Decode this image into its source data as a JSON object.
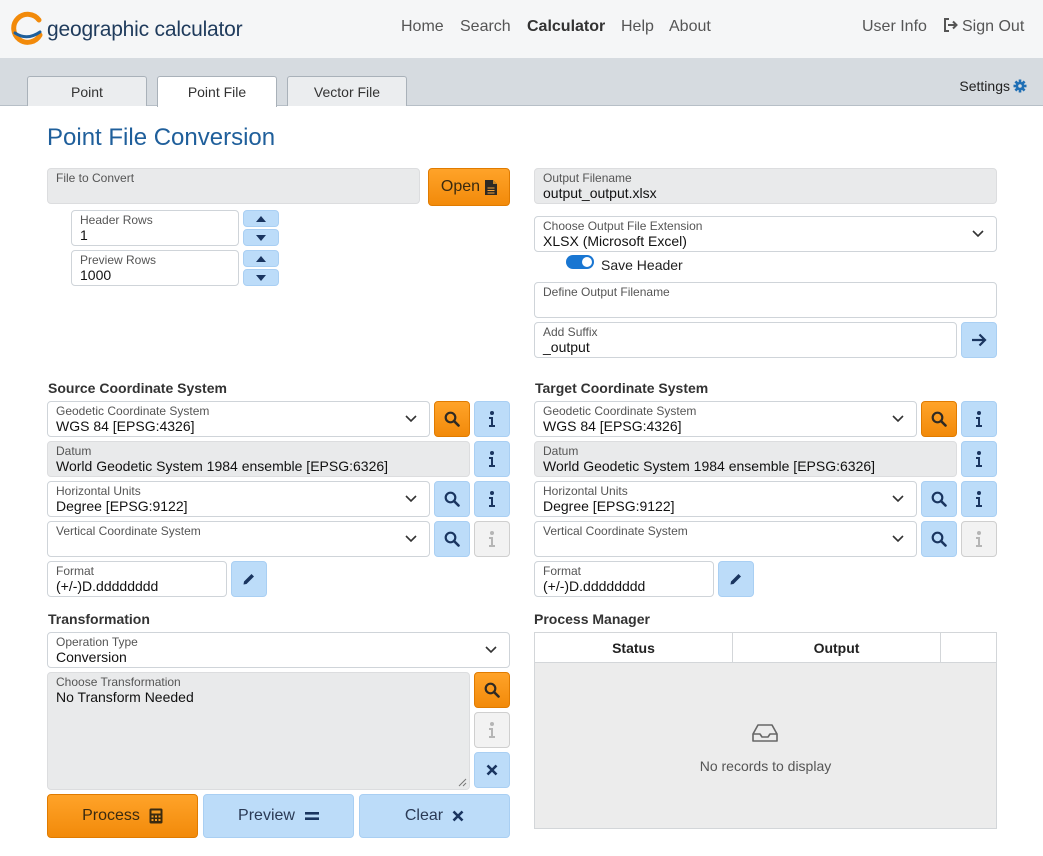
{
  "app": {
    "brand": "geographic calculator"
  },
  "nav": {
    "home": "Home",
    "search": "Search",
    "calculator": "Calculator",
    "help": "Help",
    "about": "About",
    "user_info": "User Info",
    "sign_out": "Sign Out"
  },
  "tabs": {
    "point": "Point",
    "point_file": "Point File",
    "vector_file": "Vector File",
    "settings": "Settings"
  },
  "page": {
    "title": "Point File Conversion"
  },
  "input": {
    "file_label": "File to Convert",
    "file_value": "",
    "open_label": "Open",
    "header_rows_label": "Header Rows",
    "header_rows_value": "1",
    "preview_rows_label": "Preview Rows",
    "preview_rows_value": "1000"
  },
  "output": {
    "filename_label": "Output Filename",
    "filename_value": "output_output.xlsx",
    "extension_label": "Choose Output File Extension",
    "extension_value": "XLSX (Microsoft Excel)",
    "save_header_label": "Save Header",
    "save_header_on": true,
    "define_label": "Define Output Filename",
    "define_value": "",
    "suffix_label": "Add Suffix",
    "suffix_value": "_output"
  },
  "source": {
    "section": "Source Coordinate System",
    "gcs_label": "Geodetic Coordinate System",
    "gcs_value": "WGS 84 [EPSG:4326]",
    "datum_label": "Datum",
    "datum_value": "World Geodetic System 1984 ensemble [EPSG:6326]",
    "hunits_label": "Horizontal Units",
    "hunits_value": "Degree [EPSG:9122]",
    "vcs_label": "Vertical Coordinate System",
    "vcs_value": "",
    "format_label": "Format",
    "format_value": "(+/-)D.dddddddd"
  },
  "target": {
    "section": "Target Coordinate System",
    "gcs_label": "Geodetic Coordinate System",
    "gcs_value": "WGS 84 [EPSG:4326]",
    "datum_label": "Datum",
    "datum_value": "World Geodetic System 1984 ensemble [EPSG:6326]",
    "hunits_label": "Horizontal Units",
    "hunits_value": "Degree [EPSG:9122]",
    "vcs_label": "Vertical Coordinate System",
    "vcs_value": "",
    "format_label": "Format",
    "format_value": "(+/-)D.dddddddd"
  },
  "transformation": {
    "section": "Transformation",
    "op_label": "Operation Type",
    "op_value": "Conversion",
    "choose_label": "Choose Transformation",
    "choose_value": "No Transform Needed"
  },
  "actions": {
    "process": "Process",
    "preview": "Preview",
    "clear": "Clear"
  },
  "process_manager": {
    "section": "Process Manager",
    "columns": [
      "Status",
      "Output"
    ],
    "empty_text": "No records to display"
  },
  "colors": {
    "accent": "#f28a0a",
    "primary_blue": "#1f5f9b",
    "button_blue": "#bcdcf9",
    "toggle": "#1976d2"
  },
  "icons": [
    "logo-icon",
    "sign-out-icon",
    "gear-icon",
    "file-icon",
    "arrow-right-icon",
    "search-icon",
    "info-icon",
    "pencil-icon",
    "calculator-icon",
    "equals-icon",
    "close-icon",
    "inbox-icon",
    "chevron-down-icon",
    "chevron-up-icon"
  ]
}
